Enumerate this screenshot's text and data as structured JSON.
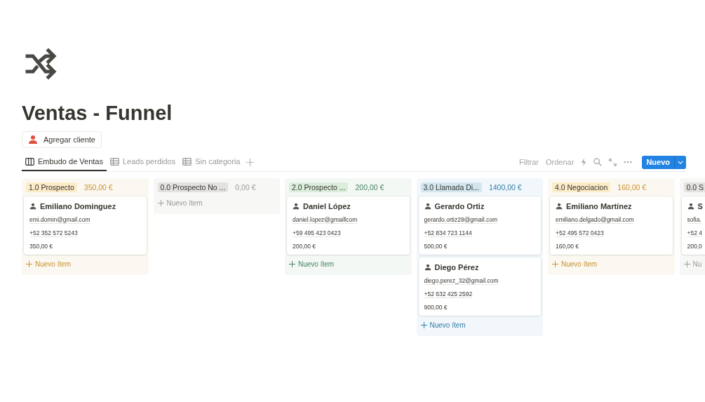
{
  "page": {
    "title": "Ventas - Funnel"
  },
  "action_button": {
    "label": "Agregar cliente"
  },
  "tabs": [
    {
      "label": "Embudo de Ventas",
      "kind": "board",
      "selected": true
    },
    {
      "label": "Leads perdidos",
      "kind": "table",
      "selected": false
    },
    {
      "label": "Sin categoria",
      "kind": "table",
      "selected": false
    }
  ],
  "toolbar": {
    "filter": "Filtrar",
    "sort": "Ordenar",
    "new_button": "Nuevo"
  },
  "columns": [
    {
      "name": "1.0 Prospecto",
      "total": "350,00 €",
      "color": "#fdecc8",
      "add_label": "Nuevo ítem",
      "cards": [
        {
          "name": "Emiliano Dominguez",
          "email": "emi.domin@gmail.com",
          "phone": "+52 352 572 5243",
          "amount": "350,00 €"
        }
      ]
    },
    {
      "name": "0.0 Prospecto No ...",
      "total": "0,00 €",
      "color": "#e3e2e0",
      "add_label": "Nuevo ítem"
    },
    {
      "name": "2.0 Prospecto ...",
      "total": "200,00 €",
      "color": "#dbeddb",
      "add_label": "Nuevo ítem",
      "cards": [
        {
          "name": "Daniel López",
          "email": "daniel.lopez@gmaillcom",
          "phone": "+59 495 423 0423",
          "amount": "200,00 €"
        }
      ]
    },
    {
      "name": "3.0 Llamada Di...",
      "total": "1400,00 €",
      "color": "#d3e5ef",
      "add_label": "Nuevo ítem",
      "cards": [
        {
          "name": "Gerardo Ortiz",
          "email": "gerardo.ortiz29@gmail.com",
          "phone": "+52 834 723 1144",
          "amount": "500,00 €"
        },
        {
          "name": "Diego Pérez",
          "email": "diego.perez_32@gmail.com",
          "phone": "+52 632 425 2592",
          "amount": "900,00 €"
        }
      ]
    },
    {
      "name": "4.0 Negociacion",
      "total": "160,00 €",
      "color": "#fdecc8",
      "add_label": "Nuevo ítem",
      "cards": [
        {
          "name": "Emiliano Martínez",
          "email": "emiliano.delgado@gmail.com",
          "phone": "+52 495 572 0423",
          "amount": "160,00 €"
        }
      ]
    },
    {
      "name": "0.0 S",
      "color": "#e3e2e0",
      "add_label": "Nu",
      "cards": [
        {
          "name": "S",
          "email": "sofia.",
          "phone": "+52 4",
          "amount": "200,0"
        }
      ]
    }
  ]
}
